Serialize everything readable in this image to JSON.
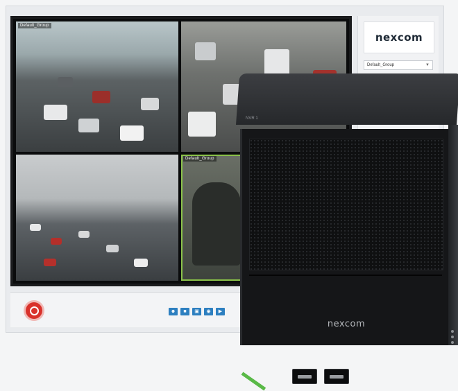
{
  "app": {
    "tiles": [
      {
        "label": "Default_Group",
        "name": "camera-tile-highway"
      },
      {
        "label": "",
        "name": "camera-tile-traffic-jam"
      },
      {
        "label": "",
        "name": "camera-tile-city-traffic"
      },
      {
        "label": "Default_Group",
        "name": "camera-tile-driver"
      }
    ],
    "side_panel": {
      "brand": "nexcom",
      "group_select_value": "Default_Group"
    },
    "toolbar": {
      "buttons": [
        "user-icon",
        "save-icon",
        "folder-icon",
        "camera-icon",
        "play-icon"
      ]
    }
  },
  "nvr": {
    "top_label": "NVR 1",
    "brand": "nexcom"
  },
  "colors": {
    "accent_blue": "#2f86c8",
    "record_red": "#d9312b",
    "selected_green": "#8bc34a",
    "nvr_green": "#59b947"
  }
}
